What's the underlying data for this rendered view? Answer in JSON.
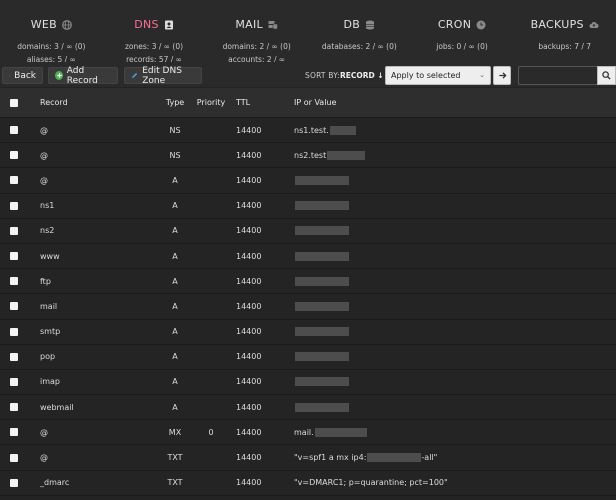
{
  "nav": [
    {
      "title": "WEB",
      "icon": "globe-icon",
      "stats": [
        "domains: 3 / ∞ (0)",
        "aliases: 5 / ∞"
      ]
    },
    {
      "title": "DNS",
      "icon": "address-book-icon",
      "stats": [
        "zones: 3 / ∞ (0)",
        "records: 57 / ∞"
      ]
    },
    {
      "title": "MAIL",
      "icon": "mail-server-icon",
      "stats": [
        "domains: 2 / ∞ (0)",
        "accounts: 2 / ∞"
      ]
    },
    {
      "title": "DB",
      "icon": "database-icon",
      "stats": [
        "databases: 2 / ∞ (0)"
      ]
    },
    {
      "title": "CRON",
      "icon": "clock-icon",
      "stats": [
        "jobs: 0 / ∞ (0)"
      ]
    },
    {
      "title": "BACKUPS",
      "icon": "cloud-upload-icon",
      "stats": [
        "backups: 7 / 7"
      ]
    }
  ],
  "toolbar": {
    "back_label": "Back",
    "add_label": "Add Record",
    "edit_label": "Edit DNS Zone",
    "sort_label": "SORT BY:",
    "sort_value": "RECORD",
    "bulk_select": "Apply to selected",
    "search_placeholder": ""
  },
  "table": {
    "headers": {
      "record": "Record",
      "type": "Type",
      "priority": "Priority",
      "ttl": "TTL",
      "ip": "IP or Value"
    },
    "rows": [
      {
        "record": "@",
        "type": "NS",
        "priority": "",
        "ttl": "14400",
        "ip": "ns1.test."
      },
      {
        "record": "@",
        "type": "NS",
        "priority": "",
        "ttl": "14400",
        "ip": "ns2.test"
      },
      {
        "record": "@",
        "type": "A",
        "priority": "",
        "ttl": "14400",
        "ip": ""
      },
      {
        "record": "ns1",
        "type": "A",
        "priority": "",
        "ttl": "14400",
        "ip": ""
      },
      {
        "record": "ns2",
        "type": "A",
        "priority": "",
        "ttl": "14400",
        "ip": ""
      },
      {
        "record": "www",
        "type": "A",
        "priority": "",
        "ttl": "14400",
        "ip": ""
      },
      {
        "record": "ftp",
        "type": "A",
        "priority": "",
        "ttl": "14400",
        "ip": ""
      },
      {
        "record": "mail",
        "type": "A",
        "priority": "",
        "ttl": "14400",
        "ip": ""
      },
      {
        "record": "smtp",
        "type": "A",
        "priority": "",
        "ttl": "14400",
        "ip": ""
      },
      {
        "record": "pop",
        "type": "A",
        "priority": "",
        "ttl": "14400",
        "ip": ""
      },
      {
        "record": "imap",
        "type": "A",
        "priority": "",
        "ttl": "14400",
        "ip": ""
      },
      {
        "record": "webmail",
        "type": "A",
        "priority": "",
        "ttl": "14400",
        "ip": ""
      },
      {
        "record": "@",
        "type": "MX",
        "priority": "0",
        "ttl": "14400",
        "ip": "mail."
      },
      {
        "record": "@",
        "type": "TXT",
        "priority": "",
        "ttl": "14400",
        "ip": "\"v=spf1 a mx ip4:",
        "ip_suffix": "-all\""
      },
      {
        "record": "_dmarc",
        "type": "TXT",
        "priority": "",
        "ttl": "14400",
        "ip": "\"v=DMARC1; p=quarantine; pct=100\""
      }
    ]
  },
  "colors": {
    "accent_active": "#ff6f97",
    "add_icon": "#4caf50",
    "back_icon": "#4fa3e0",
    "edit_icon": "#4fa3e0"
  }
}
